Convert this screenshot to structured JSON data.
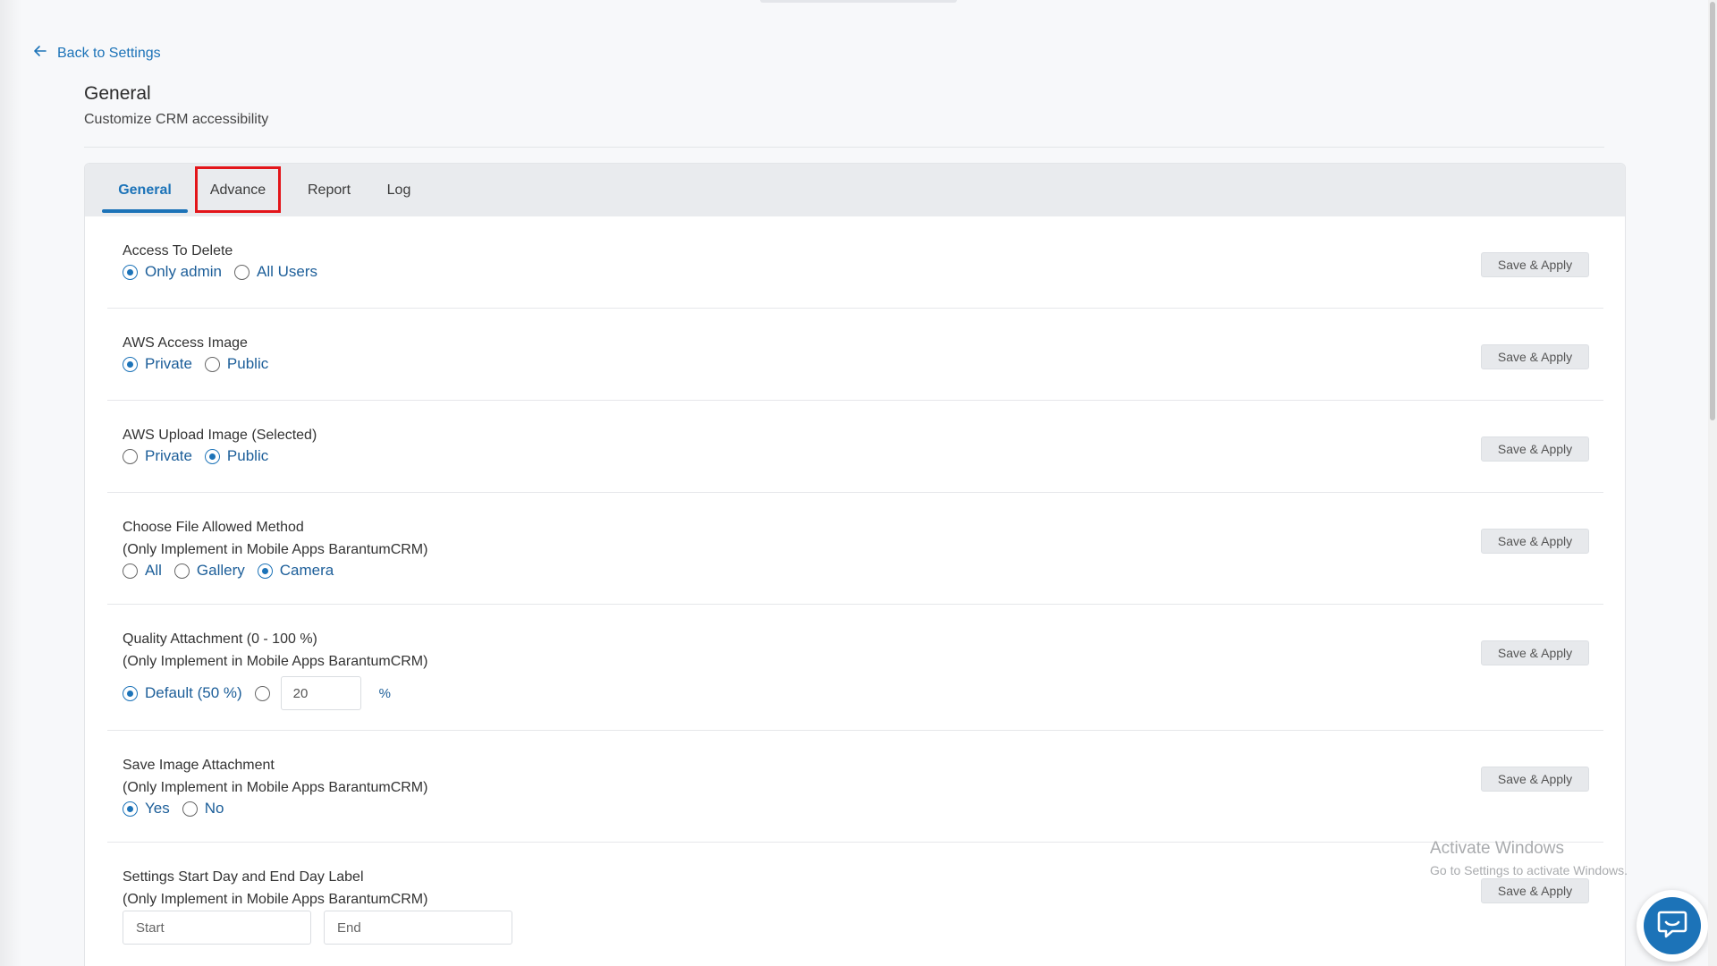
{
  "nav": {
    "back_label": "Back to Settings"
  },
  "header": {
    "title": "General",
    "subtitle": "Customize CRM accessibility"
  },
  "tabs": [
    {
      "label": "General",
      "active": true
    },
    {
      "label": "Advance",
      "active": false
    },
    {
      "label": "Report",
      "active": false
    },
    {
      "label": "Log",
      "active": false
    }
  ],
  "save_label": "Save & Apply",
  "settings": {
    "access_delete": {
      "label": "Access To Delete",
      "options": [
        "Only admin",
        "All Users"
      ],
      "selected": "Only admin"
    },
    "aws_access": {
      "label": "AWS Access Image",
      "options": [
        "Private",
        "Public"
      ],
      "selected": "Private"
    },
    "aws_upload": {
      "label": "AWS Upload Image (Selected)",
      "options": [
        "Private",
        "Public"
      ],
      "selected": "Public"
    },
    "file_method": {
      "label": "Choose File Allowed Method",
      "note": "(Only Implement in Mobile Apps BarantumCRM)",
      "options": [
        "All",
        "Gallery",
        "Camera"
      ],
      "selected": "Camera"
    },
    "quality": {
      "label": "Quality Attachment (0 - 100 %)",
      "note": "(Only Implement in Mobile Apps BarantumCRM)",
      "default_option": "Default (50 %)",
      "custom_value": "20",
      "unit": "%",
      "selected": "default"
    },
    "save_image": {
      "label": "Save Image Attachment",
      "note": "(Only Implement in Mobile Apps BarantumCRM)",
      "options": [
        "Yes",
        "No"
      ],
      "selected": "Yes"
    },
    "day_label": {
      "label": "Settings Start Day and End Day Label",
      "note": "(Only Implement in Mobile Apps BarantumCRM)",
      "start_placeholder": "Start",
      "end_placeholder": "End"
    }
  },
  "watermark": {
    "title": "Activate Windows",
    "subtitle": "Go to Settings to activate Windows."
  },
  "colors": {
    "accent": "#1c73b8",
    "highlight": "#e3151a"
  }
}
